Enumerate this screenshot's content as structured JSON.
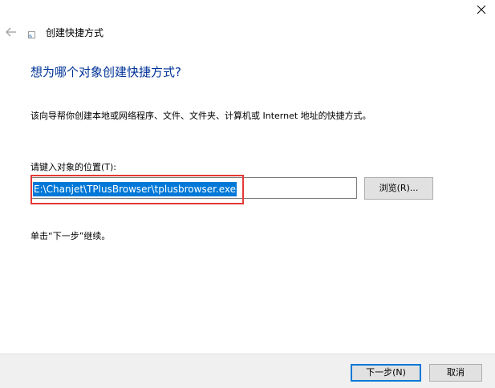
{
  "window": {
    "title": "创建快捷方式",
    "close_icon": "close-icon",
    "back_icon": "back-arrow-icon",
    "title_icon": "shortcut-icon"
  },
  "main": {
    "heading": "想为哪个对象创建快捷方式?",
    "description": "该向导帮你创建本地或网络程序、文件、文件夹、计算机或 Internet 地址的快捷方式。",
    "location_label": "请键入对象的位置(T):",
    "location_value": "E:\\Chanjet\\TPlusBrowser\\tplusbrowser.exe",
    "browse_label": "浏览(R)...",
    "instruction": "单击“下一步”继续。"
  },
  "footer": {
    "next_label": "下一步(N)",
    "cancel_label": "取消"
  },
  "colors": {
    "heading": "#003399",
    "selection": "#0078d7",
    "highlight_box": "#e53935",
    "footer_bg": "#f0f0f0",
    "button_bg": "#e1e1e1"
  }
}
